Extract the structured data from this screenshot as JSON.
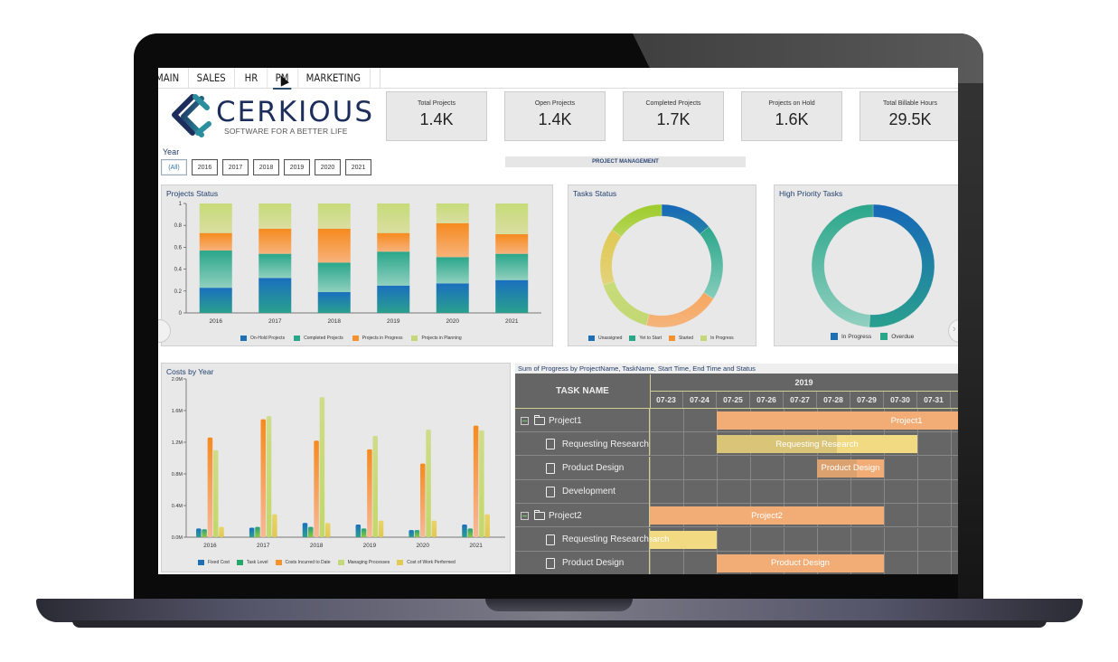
{
  "tabs": [
    {
      "label": "MAIN",
      "active": false
    },
    {
      "label": "SALES",
      "active": false
    },
    {
      "label": "HR",
      "active": false
    },
    {
      "label": "PM",
      "active": true
    },
    {
      "label": "MARKETING",
      "active": false
    }
  ],
  "logo": {
    "name": "CERKIOUS",
    "tagline": "SOFTWARE FOR A BETTER LIFE"
  },
  "year_filter": {
    "label": "Year",
    "options": [
      "(All)",
      "2016",
      "2017",
      "2018",
      "2019",
      "2020",
      "2021"
    ],
    "selected": "(All)"
  },
  "kpis": [
    {
      "label": "Total Projects",
      "value": "1.4K"
    },
    {
      "label": "Open Projects",
      "value": "1.4K"
    },
    {
      "label": "Completed Projects",
      "value": "1.7K"
    },
    {
      "label": "Projects on Hold",
      "value": "1.6K"
    },
    {
      "label": "Total Billable Hours",
      "value": "29.5K"
    }
  ],
  "section_banner": "PROJECT MANAGEMENT",
  "colors": {
    "on_hold": "#1f6fb5",
    "completed": "#2aa68a",
    "in_progress": "#f5922e",
    "planning": "#c4d879",
    "yellow": "#e2cb55",
    "bright_green": "#9ccc2a",
    "panel_bg": "#e8e8e8",
    "title": "#22406e"
  },
  "chart_data": [
    {
      "id": "projects_status",
      "type": "bar",
      "stacked": true,
      "title": "Projects Status",
      "categories": [
        "2016",
        "2017",
        "2018",
        "2019",
        "2020",
        "2021"
      ],
      "series": [
        {
          "name": "On-Hold Projects",
          "values": [
            0.23,
            0.32,
            0.19,
            0.25,
            0.27,
            0.3
          ]
        },
        {
          "name": "Completed Projects",
          "values": [
            0.34,
            0.22,
            0.27,
            0.31,
            0.24,
            0.24
          ]
        },
        {
          "name": "Projects in Progress",
          "values": [
            0.16,
            0.23,
            0.31,
            0.17,
            0.31,
            0.18
          ]
        },
        {
          "name": "Projects in Planning",
          "values": [
            0.27,
            0.23,
            0.23,
            0.27,
            0.18,
            0.28
          ]
        }
      ],
      "yticks": [
        "0",
        "0.2",
        "0.4",
        "0.6",
        "0.8",
        "1"
      ],
      "ylim": [
        0,
        1
      ],
      "legend": "bottom"
    },
    {
      "id": "tasks_status",
      "type": "pie",
      "donut": true,
      "title": "Tasks Status",
      "slices": [
        {
          "name": "Unassigned",
          "value": 14
        },
        {
          "name": "Yet to Start",
          "value": 20
        },
        {
          "name": "Started",
          "value": 20
        },
        {
          "name": "In Progress",
          "value": 16
        },
        {
          "name": "",
          "value": 15
        },
        {
          "name": "",
          "value": 15
        }
      ],
      "legend_entries": [
        "Unassigned",
        "Yet to Start",
        "Started",
        "In Progress"
      ],
      "legend": "bottom"
    },
    {
      "id": "high_priority_tasks",
      "type": "pie",
      "donut": true,
      "title": "High Priority Tasks",
      "slices": [
        {
          "name": "In Progress",
          "value": 51
        },
        {
          "name": "Overdue",
          "value": 49
        }
      ],
      "legend_entries": [
        "In Progress",
        "Overdue"
      ],
      "legend": "bottom"
    },
    {
      "id": "costs_by_year",
      "type": "bar",
      "stacked": false,
      "title": "Costs by Year",
      "categories": [
        "2016",
        "2017",
        "2018",
        "2019",
        "2020",
        "2021"
      ],
      "series": [
        {
          "name": "Fixed Cost",
          "values": [
            0.11,
            0.12,
            0.18,
            0.16,
            0.09,
            0.16
          ]
        },
        {
          "name": "Task Level",
          "values": [
            0.1,
            0.13,
            0.13,
            0.11,
            0.09,
            0.11
          ]
        },
        {
          "name": "Costs Incurred to Date",
          "values": [
            1.26,
            1.49,
            1.22,
            1.11,
            0.93,
            1.41
          ]
        },
        {
          "name": "Managing Processes",
          "values": [
            1.1,
            1.53,
            1.77,
            1.28,
            1.36,
            1.35
          ]
        },
        {
          "name": "Cost of Work Performed",
          "values": [
            0.13,
            0.29,
            0.18,
            0.21,
            0.21,
            0.29
          ]
        }
      ],
      "yticks": [
        "0.0M",
        "0.4M",
        "0.8M",
        "1.2M",
        "1.6M",
        "2.0M"
      ],
      "ylim": [
        0,
        2.0
      ],
      "yunit": "M",
      "legend": "bottom"
    }
  ],
  "gantt": {
    "title": "Sum of Progress by ProjectName, TaskName, Start Time, End Time and Status",
    "task_header": "TASK NAME",
    "year": "2019",
    "days": [
      "07-23",
      "07-24",
      "07-25",
      "07-26",
      "07-27",
      "07-28",
      "07-29",
      "07-30",
      "07-31"
    ],
    "rows": [
      {
        "name": "Project1",
        "type": "project",
        "bar": {
          "label": "Project1",
          "start": 2,
          "end": 9.5,
          "progress": 0,
          "color": "#f2ad76"
        }
      },
      {
        "name": "Requesting Research",
        "type": "task",
        "bar": {
          "label": "Requesting Research",
          "start": 2,
          "end": 8,
          "progress": 0.6,
          "color": "#f1da82"
        }
      },
      {
        "name": "Product Design",
        "type": "task",
        "bar": {
          "label": "Product Design",
          "start": 5,
          "end": 7,
          "progress": 0.6,
          "color": "#f2ad76"
        }
      },
      {
        "name": "Development",
        "type": "task",
        "bar": null
      },
      {
        "name": "Project2",
        "type": "project",
        "bar": {
          "label": "Project2",
          "start": 0,
          "end": 7,
          "progress": 0,
          "color": "#f2ad76"
        }
      },
      {
        "name": "Requesting Research",
        "type": "task",
        "bar": {
          "label": "Requesting Research",
          "start": 0,
          "end": 2,
          "progress": 0,
          "color": "#f1da82"
        }
      },
      {
        "name": "Product Design",
        "type": "task",
        "bar": {
          "label": "Product Design",
          "start": 2,
          "end": 7,
          "progress": 0,
          "color": "#f2ad76"
        }
      }
    ]
  }
}
